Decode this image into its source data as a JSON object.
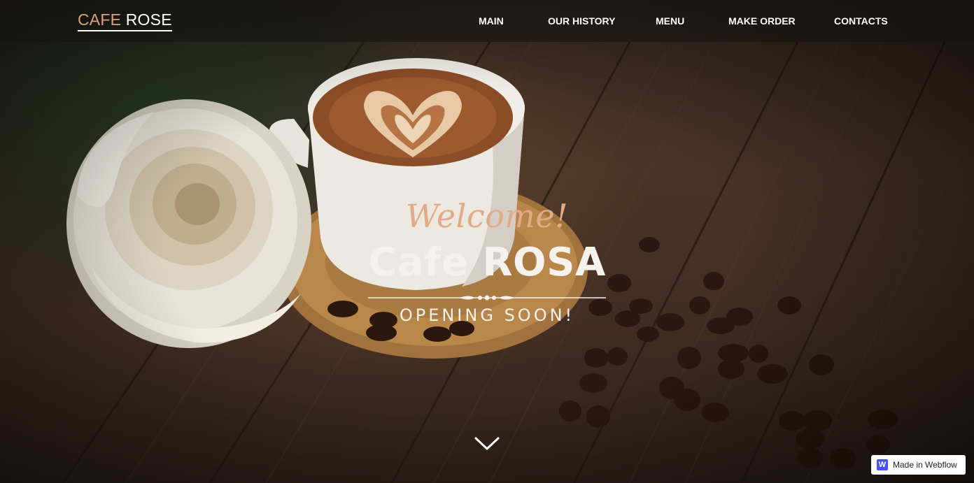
{
  "nav": {
    "logo_part1": "CAFE",
    "logo_part2": "ROSE",
    "links": [
      {
        "label": "MAIN"
      },
      {
        "label": "OUR HISTORY"
      },
      {
        "label": "MENU"
      },
      {
        "label": "MAKE ORDER"
      },
      {
        "label": "CONTACTS"
      }
    ]
  },
  "hero": {
    "welcome": "Welcome!",
    "title": "Cafe ROSA",
    "subtitle": "OPENING SOON!",
    "scroll_icon": "chevron-down-icon"
  },
  "badge": {
    "icon_letter": "W",
    "label": "Made in Webflow"
  },
  "colors": {
    "accent": "#d9a27c",
    "welcome": "#e3ab85",
    "text": "#f5f1ec",
    "badge_icon": "#4353ff"
  }
}
